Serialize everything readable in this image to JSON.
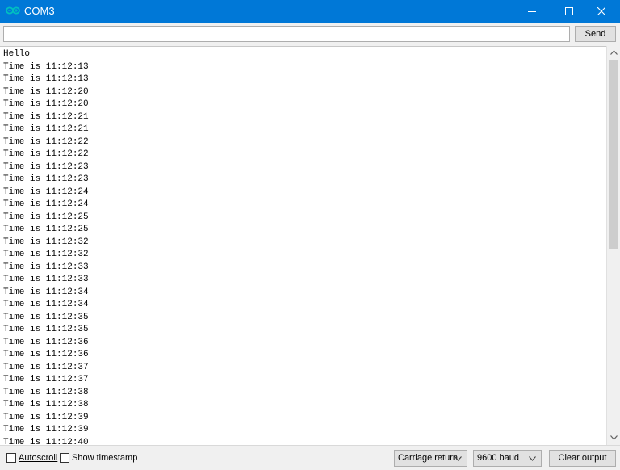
{
  "window": {
    "title": "COM3",
    "app_icon": "arduino-infinity-icon",
    "controls": [
      "minimize-icon",
      "maximize-icon",
      "close-icon"
    ],
    "titlebar_color": "#0078d7"
  },
  "input_bar": {
    "input_value": "",
    "send_label": "Send"
  },
  "output": {
    "lines": [
      "Hello",
      "Time is 11:12:13",
      "Time is 11:12:13",
      "Time is 11:12:20",
      "Time is 11:12:20",
      "Time is 11:12:21",
      "Time is 11:12:21",
      "Time is 11:12:22",
      "Time is 11:12:22",
      "Time is 11:12:23",
      "Time is 11:12:23",
      "Time is 11:12:24",
      "Time is 11:12:24",
      "Time is 11:12:25",
      "Time is 11:12:25",
      "Time is 11:12:32",
      "Time is 11:12:32",
      "Time is 11:12:33",
      "Time is 11:12:33",
      "Time is 11:12:34",
      "Time is 11:12:34",
      "Time is 11:12:35",
      "Time is 11:12:35",
      "Time is 11:12:36",
      "Time is 11:12:36",
      "Time is 11:12:37",
      "Time is 11:12:37",
      "Time is 11:12:38",
      "Time is 11:12:38",
      "Time is 11:12:39",
      "Time is 11:12:39",
      "Time is 11:12:40"
    ]
  },
  "status_bar": {
    "autoscroll_label": "Autoscroll",
    "autoscroll_checked": false,
    "timestamp_label": "Show timestamp",
    "timestamp_checked": false,
    "line_ending": "Carriage return",
    "baud": "9600 baud",
    "clear_label": "Clear output"
  }
}
